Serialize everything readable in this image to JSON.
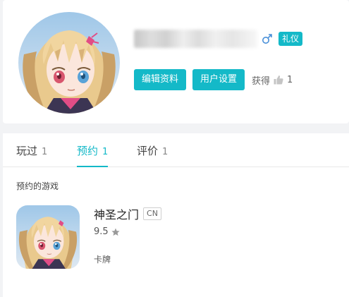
{
  "profile": {
    "gender_icon": "male-icon",
    "badge": "礼仪",
    "buttons": {
      "edit_profile": "编辑资料",
      "user_settings": "用户设置"
    },
    "gain_label": "获得",
    "like_icon": "thumbs-up-icon",
    "gain_count": "1"
  },
  "tabs": [
    {
      "label": "玩过",
      "count": "1",
      "active": false
    },
    {
      "label": "预约",
      "count": "1",
      "active": true
    },
    {
      "label": "评价",
      "count": "1",
      "active": false
    }
  ],
  "reserved": {
    "section_title": "预约的游戏",
    "game": {
      "name": "神圣之门",
      "region": "CN",
      "rating": "9.5",
      "rating_icon": "star-icon",
      "genre": "卡牌"
    }
  },
  "colors": {
    "accent": "#14b9c8",
    "page_background": "#f2f3f5",
    "card_background": "#ffffff"
  }
}
